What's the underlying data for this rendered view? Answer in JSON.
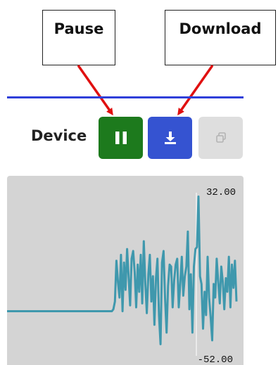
{
  "callouts": {
    "pause": "Pause",
    "download": "Download"
  },
  "toolbar": {
    "device_label": "Device",
    "pause_icon": "pause-icon",
    "download_icon": "download-icon",
    "copy_icon": "copy-icon"
  },
  "colors": {
    "divider": "#2f3fd9",
    "pause_button": "#1d7a1d",
    "download_button": "#3553d1",
    "copy_button": "#dedede",
    "signal_line": "#3f98ad",
    "callout_arrow": "#e01010",
    "chart_background": "#d4d4d4"
  },
  "chart_data": {
    "type": "line",
    "title": "",
    "xlabel": "",
    "ylabel": "",
    "ylim": [
      -52,
      32
    ],
    "y_tick_labels": [
      "32.00",
      "-52.00"
    ],
    "grid": false,
    "series": [
      {
        "values": [
          -29,
          -29,
          -29,
          -29,
          -29,
          -29,
          -29,
          -29,
          -29,
          -29,
          -29,
          -29,
          -29,
          -29,
          -29,
          -29,
          -29,
          -29,
          -29,
          -29,
          -29,
          -29,
          -29,
          -29,
          -29,
          -29,
          -29,
          -29,
          -29,
          -29,
          -29,
          -29,
          -29,
          -29,
          -29,
          -29,
          -29,
          -29,
          -29,
          -29,
          -29,
          -29,
          -29,
          -29,
          -29,
          -29,
          -29,
          -29,
          -29,
          -29,
          -29,
          -29,
          -29,
          -29,
          -29,
          -29,
          -29,
          -29,
          -29,
          -29,
          -29,
          -29,
          -29,
          -29,
          -29,
          -29,
          -29,
          -29,
          -29,
          -29,
          -28,
          -24,
          -3,
          -14,
          -22,
          0,
          -29,
          -4,
          -18,
          3,
          -11,
          -26,
          -2,
          2,
          -9,
          -27,
          -5,
          -19,
          0,
          -25,
          7,
          -15,
          -30,
          -10,
          0,
          -24,
          -11,
          -36,
          -12,
          -2,
          -31,
          -46,
          -4,
          2,
          -22,
          -40,
          -16,
          -5,
          -6,
          -27,
          -13,
          -5,
          -2,
          -27,
          -15,
          -1,
          -21,
          -11,
          -6,
          12,
          -28,
          -10,
          -40,
          -6,
          3,
          4,
          30,
          -11,
          -15,
          -38,
          -19,
          -31,
          -1,
          -22,
          -32,
          -44,
          -15,
          -22,
          -2,
          -14,
          -25,
          -6,
          -14,
          -28,
          -12,
          -19,
          -1,
          -27,
          -5,
          -17,
          -3,
          -24
        ]
      }
    ]
  }
}
